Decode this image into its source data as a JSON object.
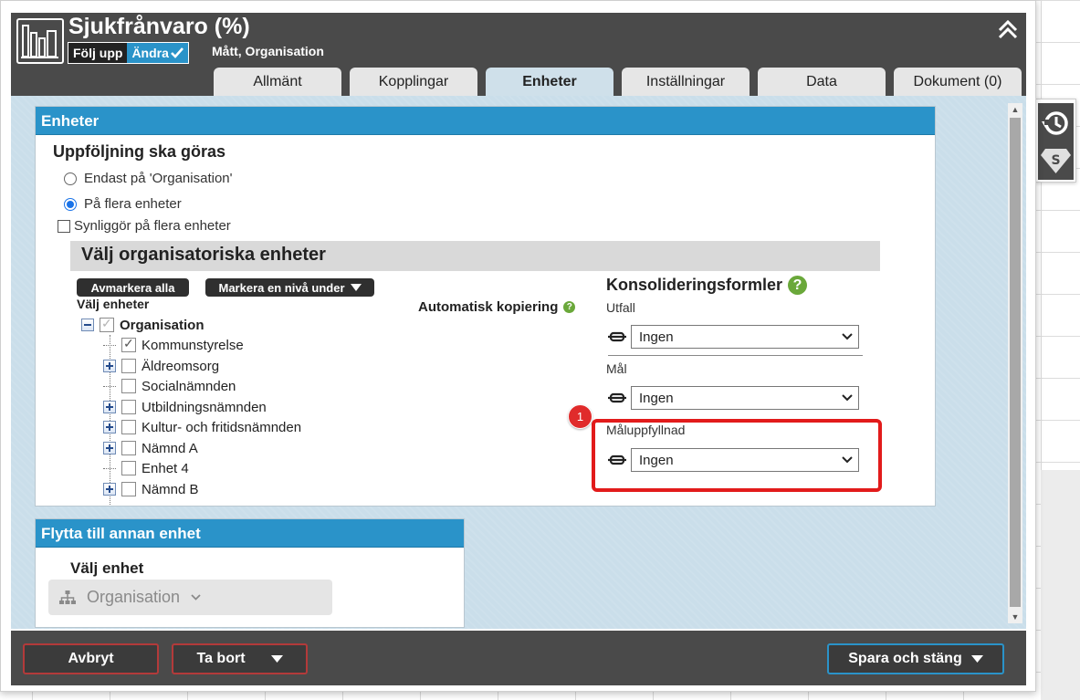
{
  "header": {
    "title": "Sjukfrånvaro (%)",
    "mode_follow": "Följ upp",
    "mode_edit": "Ändra",
    "subtitle": "Mått, Organisation"
  },
  "tabs": [
    {
      "label": "Allmänt",
      "active": false
    },
    {
      "label": "Kopplingar",
      "active": false
    },
    {
      "label": "Enheter",
      "active": true
    },
    {
      "label": "Inställningar",
      "active": false
    },
    {
      "label": "Data",
      "active": false
    },
    {
      "label": "Dokument (0)",
      "active": false
    }
  ],
  "enheter": {
    "section_title": "Enheter",
    "follow_heading": "Uppföljning ska göras",
    "radio_only": "Endast på 'Organisation'",
    "radio_multi": "På flera enheter",
    "radio_selected": "multi",
    "visible_checkbox": "Synliggör på flera enheter",
    "visible_checked": false,
    "org_heading": "Välj organisatoriska enheter",
    "btn_unmark": "Avmarkera alla",
    "btn_mark_level": "Markera en nivå under",
    "choose_units": "Välj enheter",
    "tree": [
      {
        "label": "Organisation",
        "level": 0,
        "expander": "minus",
        "checked": true,
        "bold": true,
        "dim": true
      },
      {
        "label": "Kommunstyrelse",
        "level": 1,
        "expander": "none",
        "checked": true
      },
      {
        "label": "Äldreomsorg",
        "level": 1,
        "expander": "plus",
        "checked": false
      },
      {
        "label": "Socialnämnden",
        "level": 1,
        "expander": "none",
        "checked": false
      },
      {
        "label": "Utbildningsnämnden",
        "level": 1,
        "expander": "plus",
        "checked": false
      },
      {
        "label": "Kultur- och fritidsnämnden",
        "level": 1,
        "expander": "plus",
        "checked": false
      },
      {
        "label": "Nämnd A",
        "level": 1,
        "expander": "plus",
        "checked": false
      },
      {
        "label": "Enhet 4",
        "level": 1,
        "expander": "none",
        "checked": false
      },
      {
        "label": "Nämnd B",
        "level": 1,
        "expander": "plus",
        "checked": false
      }
    ],
    "auto_copy": "Automatisk kopiering",
    "consolidation_title": "Konsolideringsformler",
    "utfall_label": "Utfall",
    "utfall_value": "Ingen",
    "mal_label": "Mål",
    "mal_value": "Ingen",
    "maluppfyllnad_label": "Måluppfyllnad",
    "maluppfyllnad_value": "Ingen",
    "annotation_badge": "1"
  },
  "move": {
    "section_title": "Flytta till annan enhet",
    "choose_unit": "Välj enhet",
    "unit_value": "Organisation"
  },
  "footer": {
    "cancel": "Avbryt",
    "delete": "Ta bort",
    "save_close": "Spara och stäng"
  },
  "colors": {
    "header_bg": "#4a4a4a",
    "accent": "#2a93c9",
    "content_bg": "#cadeea",
    "highlight": "#e21b1b",
    "help": "#6aa83a"
  }
}
